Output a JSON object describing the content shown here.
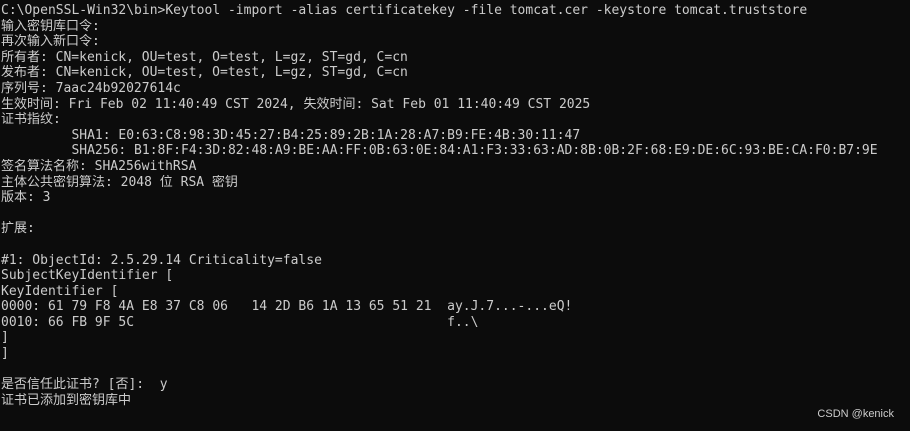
{
  "terminal": {
    "background": "#0c0c0c",
    "foreground": "#cccccc",
    "lines": [
      "C:\\OpenSSL-Win32\\bin>Keytool -import -alias certificatekey -file tomcat.cer -keystore tomcat.truststore",
      "输入密钥库口令:",
      "再次输入新口令:",
      "所有者: CN=kenick, OU=test, O=test, L=gz, ST=gd, C=cn",
      "发布者: CN=kenick, OU=test, O=test, L=gz, ST=gd, C=cn",
      "序列号: 7aac24b92027614c",
      "生效时间: Fri Feb 02 11:40:49 CST 2024, 失效时间: Sat Feb 01 11:40:49 CST 2025",
      "证书指纹:",
      "         SHA1: E0:63:C8:98:3D:45:27:B4:25:89:2B:1A:28:A7:B9:FE:4B:30:11:47",
      "         SHA256: B1:8F:F4:3D:82:48:A9:BE:AA:FF:0B:63:0E:84:A1:F3:33:63:AD:8B:0B:2F:68:E9:DE:6C:93:BE:CA:F0:B7:9E",
      "签名算法名称: SHA256withRSA",
      "主体公共密钥算法: 2048 位 RSA 密钥",
      "版本: 3",
      "",
      "扩展:",
      "",
      "#1: ObjectId: 2.5.29.14 Criticality=false",
      "SubjectKeyIdentifier [",
      "KeyIdentifier [",
      "0000: 61 79 F8 4A E8 37 C8 06   14 2D B6 1A 13 65 51 21  ay.J.7...-...eQ!",
      "0010: 66 FB 9F 5C                                        f..\\",
      "]",
      "]",
      "",
      "是否信任此证书? [否]:  y",
      "证书已添加到密钥库中"
    ]
  },
  "watermark": "CSDN @kenick"
}
